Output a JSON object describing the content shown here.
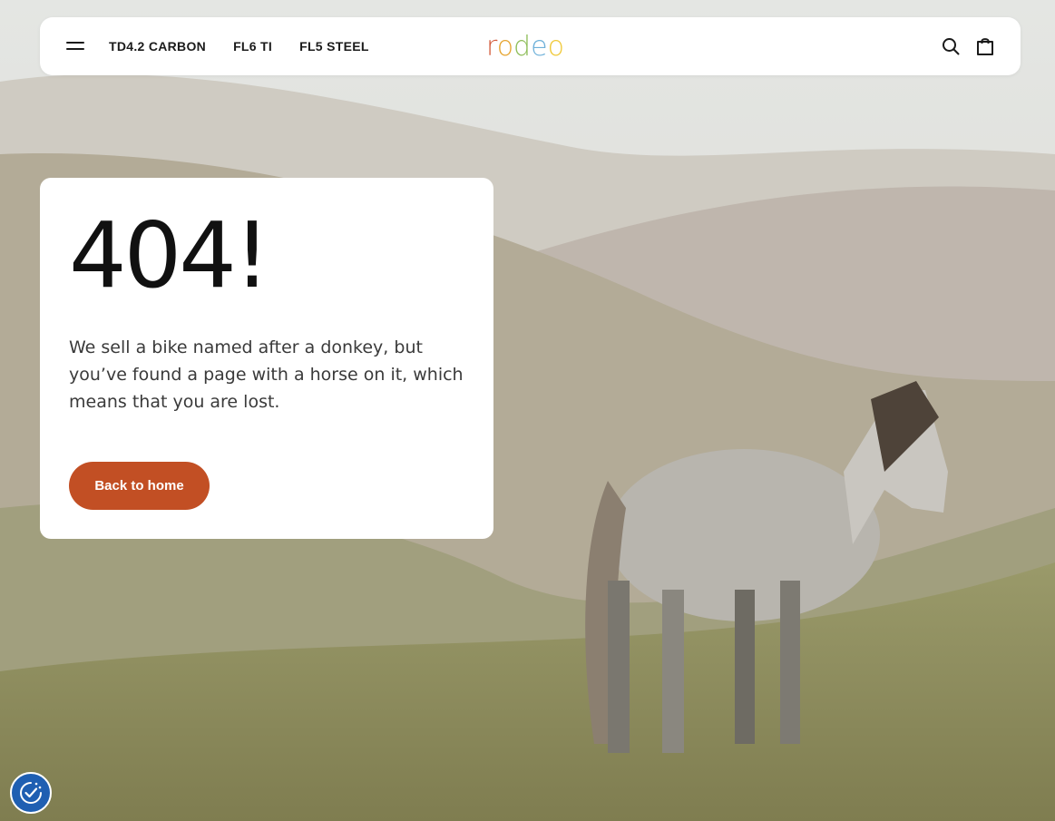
{
  "header": {
    "nav_items": [
      {
        "label": "TD4.2 CARBON"
      },
      {
        "label": "FL6 TI"
      },
      {
        "label": "FL5 STEEL"
      }
    ],
    "logo_text": "rodeo",
    "icons": {
      "menu": "hamburger-menu-icon",
      "search": "search-icon",
      "cart": "shopping-bag-icon"
    }
  },
  "error": {
    "code": "404!",
    "message": "We sell a bike named after a donkey, but you’ve found a page with a horse on it, which means that you are lost.",
    "button_label": "Back to home"
  },
  "consent": {
    "icon": "cookie-consent-icon"
  },
  "colors": {
    "accent": "#c24f24",
    "consent_blue": "#1f5fb2",
    "logo_letters": [
      "#d35a3a",
      "#e6a531",
      "#8fbe5a",
      "#6fb1d9",
      "#f0c93a"
    ]
  }
}
